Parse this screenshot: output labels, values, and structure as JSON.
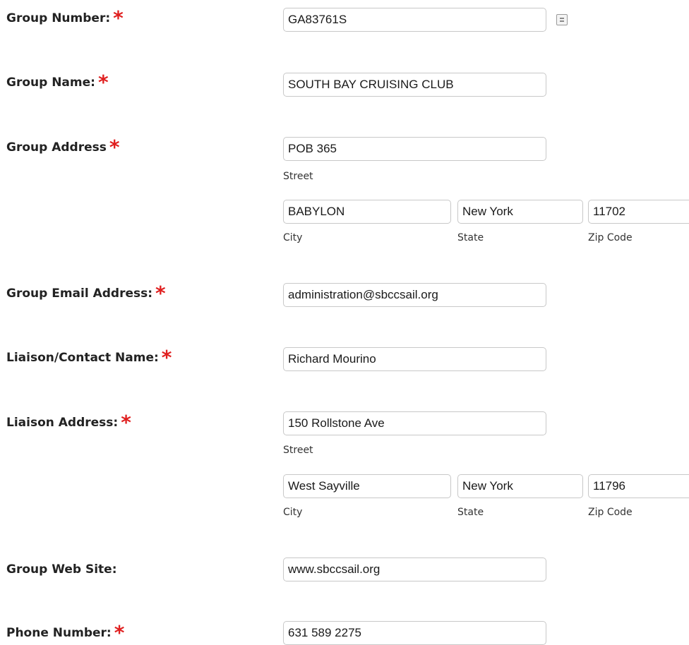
{
  "group_number": {
    "label": "Group Number:",
    "value": "GA83761S",
    "icon": "contact-card-icon"
  },
  "group_name": {
    "label": "Group Name:",
    "value": "SOUTH BAY CRUISING CLUB"
  },
  "group_address": {
    "label": "Group Address",
    "street": "POB 365",
    "city": "BABYLON",
    "state": "New York",
    "zip": "11702"
  },
  "group_email": {
    "label": "Group Email Address:",
    "value": "administration@sbccsail.org"
  },
  "liaison_name": {
    "label": "Liaison/Contact Name:",
    "value": "Richard Mourino"
  },
  "liaison_address": {
    "label": "Liaison Address:",
    "street": "150 Rollstone Ave",
    "city": "West Sayville",
    "state": "New York",
    "zip": "11796"
  },
  "web_site": {
    "label": "Group Web Site:",
    "value": "www.sbccsail.org"
  },
  "phone": {
    "label": "Phone Number:",
    "value": "631 589 2275"
  },
  "captions": {
    "street": "Street",
    "city": "City",
    "state": "State",
    "zip": "Zip Code"
  },
  "required_mark": "*",
  "colors": {
    "required": "#e02020",
    "border": "#c8c8c8",
    "label": "#222222"
  }
}
